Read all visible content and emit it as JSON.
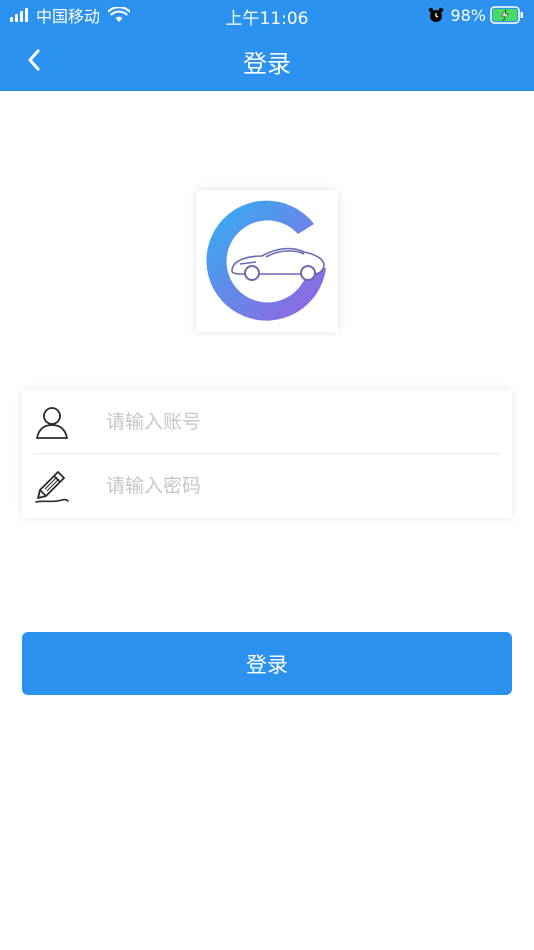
{
  "status_bar": {
    "carrier": "中国移动",
    "time": "上午11:06",
    "battery": "98%"
  },
  "nav": {
    "title": "登录"
  },
  "form": {
    "username_placeholder": "请输入账号",
    "password_placeholder": "请输入密码"
  },
  "login_button_label": "登录",
  "icons": {
    "back": "chevron-left-icon",
    "user": "user-icon",
    "password": "pencil-icon",
    "logo": "car-logo-icon"
  },
  "colors": {
    "primary": "#2b93ef",
    "placeholder": "#c6c6c6",
    "logo_gradient_start": "#2fb1f2",
    "logo_gradient_end": "#9b5fe0"
  }
}
